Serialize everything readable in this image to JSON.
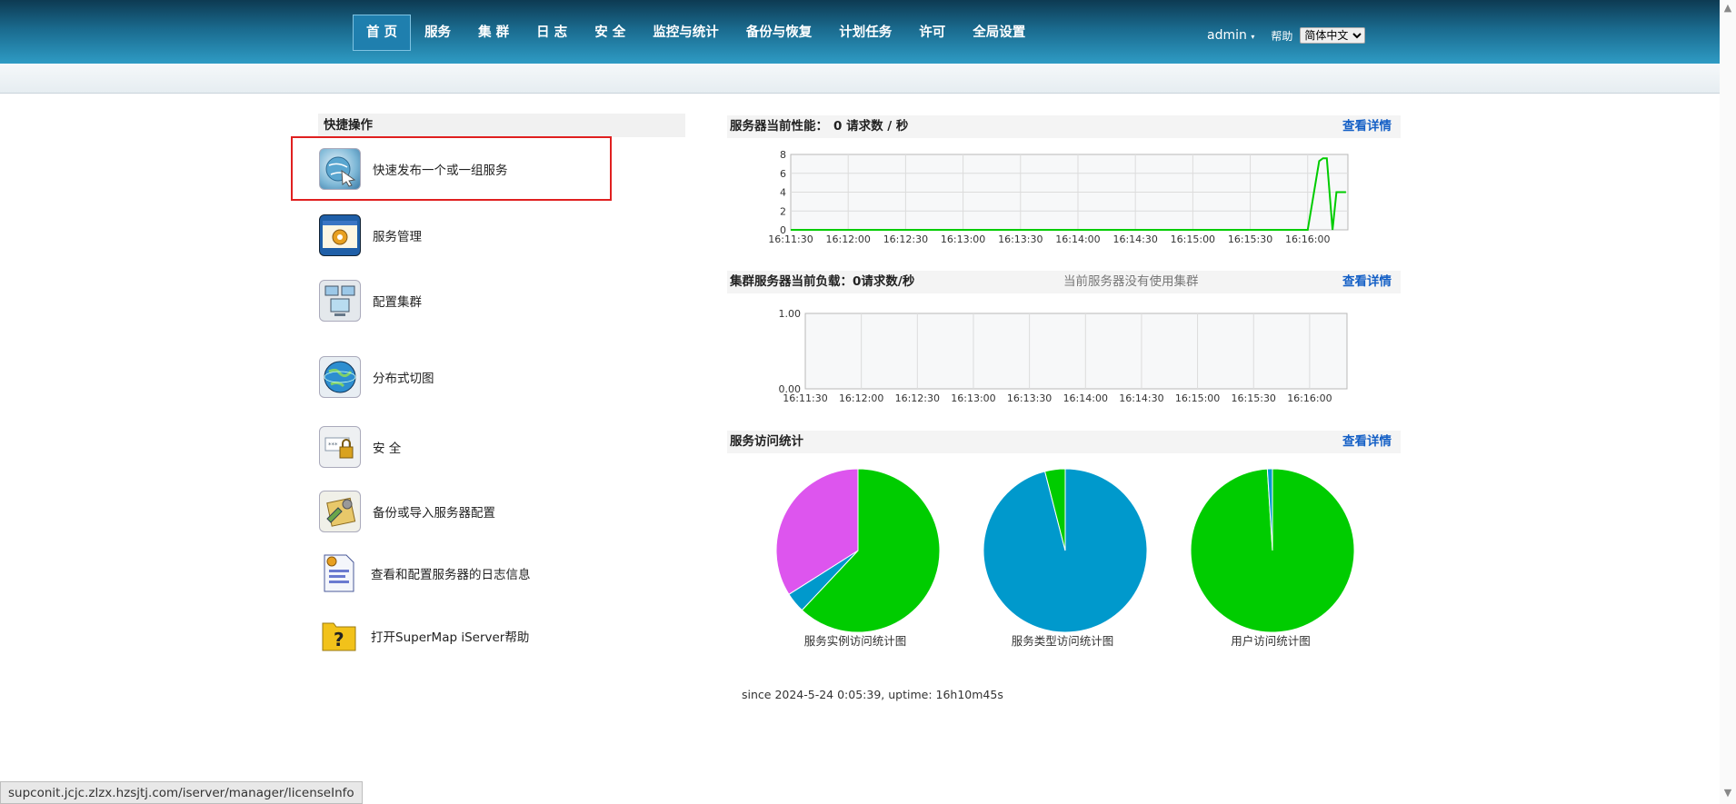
{
  "nav": {
    "items": [
      {
        "label": "首 页",
        "active": true
      },
      {
        "label": "服务"
      },
      {
        "label": "集 群"
      },
      {
        "label": "日 志"
      },
      {
        "label": "安 全"
      },
      {
        "label": "监控与统计"
      },
      {
        "label": "备份与恢复"
      },
      {
        "label": "计划任务"
      },
      {
        "label": "许可"
      },
      {
        "label": "全局设置"
      }
    ],
    "user": "admin",
    "user_caret": "▾",
    "help": "帮助",
    "language": "简体中文",
    "language_options": [
      "简体中文"
    ]
  },
  "quick": {
    "title": "快捷操作",
    "items": [
      {
        "label": "快速发布一个或一组服务",
        "icon": "publish-icon"
      },
      {
        "label": "服务管理",
        "icon": "service-manage-icon"
      },
      {
        "label": "配置集群",
        "icon": "cluster-icon"
      },
      {
        "label": "分布式切图",
        "icon": "globe-icon"
      },
      {
        "label": "安 全",
        "icon": "security-icon"
      },
      {
        "label": "备份或导入服务器配置",
        "icon": "backup-icon"
      },
      {
        "label": "查看和配置服务器的日志信息",
        "icon": "log-icon"
      },
      {
        "label": "打开SuperMap iServer帮助",
        "icon": "help-icon"
      }
    ]
  },
  "perf": {
    "title": "服务器当前性能：",
    "value": "0 请求数 / 秒",
    "detail": "查看详情"
  },
  "cluster": {
    "title": "集群服务器当前负载：",
    "value": "0请求数/秒",
    "note": "当前服务器没有使用集群",
    "detail": "查看详情"
  },
  "stats": {
    "title": "服务访问统计",
    "detail": "查看详情",
    "pies": [
      {
        "label": "服务实例访问统计图"
      },
      {
        "label": "服务类型访问统计图"
      },
      {
        "label": "用户访问统计图"
      }
    ]
  },
  "since": "since 2024-5-24 0:05:39, uptime: 16h10m45s",
  "status_url": "supconit.jcjc.zlzx.hzsjtj.com/iserver/manager/licenseInfo",
  "colors": {
    "green": "#00cc00",
    "blue": "#0099cc",
    "magenta": "#dd55ee"
  },
  "chart_data": [
    {
      "type": "line",
      "x": [
        "16:11:30",
        "16:12:00",
        "16:12:30",
        "16:13:00",
        "16:13:30",
        "16:14:00",
        "16:14:30",
        "16:15:00",
        "16:15:30",
        "16:16:00"
      ],
      "yticks": [
        "0",
        "2",
        "4",
        "6",
        "8"
      ],
      "ylim": [
        0,
        8
      ],
      "series": [
        {
          "values": [
            [
              "16:11:30",
              0
            ],
            [
              "16:12:00",
              0
            ],
            [
              "16:12:30",
              0
            ],
            [
              "16:13:00",
              0
            ],
            [
              "16:13:30",
              0
            ],
            [
              "16:14:00",
              0
            ],
            [
              "16:14:30",
              0
            ],
            [
              "16:15:00",
              0
            ],
            [
              "16:15:30",
              0
            ],
            [
              "16:16:00",
              0
            ],
            [
              "16:16:06",
              7.3
            ],
            [
              "16:16:08",
              7.6
            ],
            [
              "16:16:10",
              7.6
            ],
            [
              "16:16:13",
              0
            ],
            [
              "16:16:15",
              4
            ],
            [
              "16:16:20",
              4
            ]
          ]
        }
      ],
      "grid": true
    },
    {
      "type": "line",
      "x": [
        "16:11:30",
        "16:12:00",
        "16:12:30",
        "16:13:00",
        "16:13:30",
        "16:14:00",
        "16:14:30",
        "16:15:00",
        "16:15:30",
        "16:16:00"
      ],
      "yticks": [
        "0.00",
        "1.00"
      ],
      "ylim": [
        0,
        1
      ],
      "series": [],
      "grid": true
    },
    {
      "type": "pie",
      "label": "服务实例访问统计图",
      "values": [
        62,
        4,
        34
      ],
      "colors": [
        "#00cc00",
        "#0099cc",
        "#dd55ee"
      ]
    },
    {
      "type": "pie",
      "label": "服务类型访问统计图",
      "values": [
        96,
        4
      ],
      "colors": [
        "#0099cc",
        "#00cc00"
      ]
    },
    {
      "type": "pie",
      "label": "用户访问统计图",
      "values": [
        99,
        1
      ],
      "colors": [
        "#00cc00",
        "#0099cc"
      ]
    }
  ]
}
